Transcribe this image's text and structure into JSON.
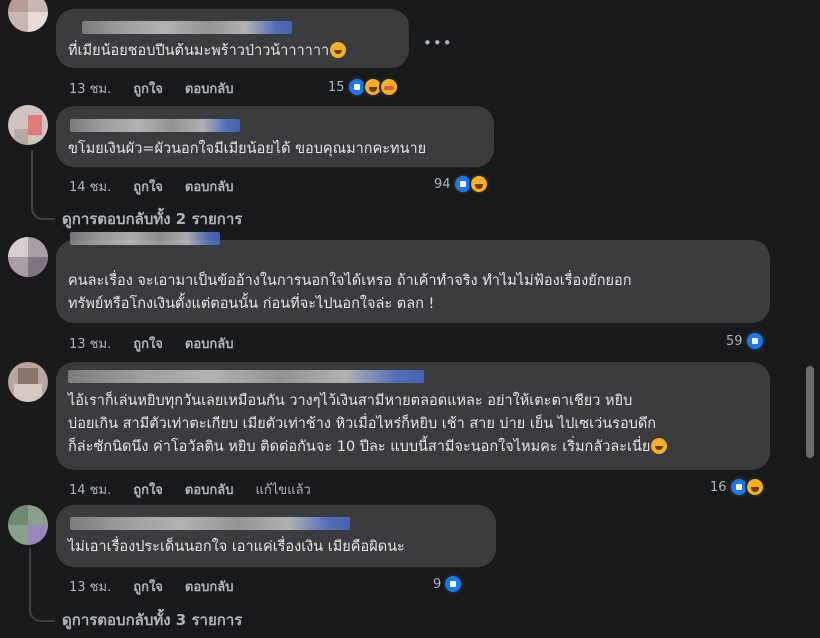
{
  "comments": [
    {
      "text_lines": [
        "ที่เมียน้อยชอบปีนต้นมะพร้าวป่าวน้าาาาาา"
      ],
      "time": "13 ชม.",
      "like_label": "ถูกใจ",
      "reply_label": "ตอบกลับ",
      "reaction_count": "15",
      "reactions": [
        "like-icon",
        "haha-icon",
        "lol-icon"
      ]
    },
    {
      "text_lines": [
        "ขโมยเงินผัว=ผัวนอกใจมีเมียน้อยได้ ขอบคุณมากคะทนาย"
      ],
      "time": "14 ชม.",
      "like_label": "ถูกใจ",
      "reply_label": "ตอบกลับ",
      "reaction_count": "94",
      "reactions": [
        "like-icon",
        "haha-icon"
      ]
    },
    {
      "text_lines": [
        "คนละเรื่อง จะเอามาเป็นข้ออ้างในการนอกใจได้เหรอ ถ้าเค้าทำจริง ทำไมไม่ฟ้องเรื่องยักยอก",
        "ทรัพย์หรือโกงเงินตั้งแต่ตอนนั้น ก่อนที่จะไปนอกใจล่ะ ตลก !"
      ],
      "time": "13 ชม.",
      "like_label": "ถูกใจ",
      "reply_label": "ตอบกลับ",
      "reaction_count": "59",
      "reactions": [
        "like-icon"
      ]
    },
    {
      "text_lines": [
        "ไอ้เราก็เล่นหยิบทุกวันเลยเหมือนกัน วางๆไว้เงินสามีหายตลอดแหละ อย่าให้เตะตาเชียว หยิบ",
        "บ่อยเกิน สามีตัวเท่าตะเกียบ เมียตัวเท่าช้าง หิวเมื่อไหร่ก็หยิบ เช้า สาย บ่าย เย็น ไปเซเว่นรอบดึก",
        "ก็ล่ะซักนิดนึง ค่าโอวัลติน หยิบ ติดต่อกันจะ 10 ปีละ แบบนี้สามีจะนอกใจไหมคะ เริ่มกลัวละเนี่ย"
      ],
      "time": "14 ชม.",
      "like_label": "ถูกใจ",
      "reply_label": "ตอบกลับ",
      "edited_label": "แก้ไขแล้ว",
      "reaction_count": "16",
      "reactions": [
        "like-icon",
        "haha-icon"
      ]
    },
    {
      "text_lines": [
        "ไม่เอาเรื่องประเด็นนอกใจ เอาแค่เรื่องเงิน เมียคือผิดนะ"
      ],
      "time": "13 ชม.",
      "like_label": "ถูกใจ",
      "reply_label": "ตอบกลับ",
      "reaction_count": "9",
      "reactions": [
        "like-icon"
      ]
    }
  ],
  "view_replies_1": "ดูการตอบกลับทั้ง 2 รายการ",
  "view_replies_2": "ดูการตอบกลับทั้ง 3 รายการ",
  "more_icon": "•••",
  "colors": {
    "background": "#18191a",
    "bubble": "#3a3b3c",
    "like_blue": "#1877f2",
    "emoji_yellow": "#f7b125"
  }
}
